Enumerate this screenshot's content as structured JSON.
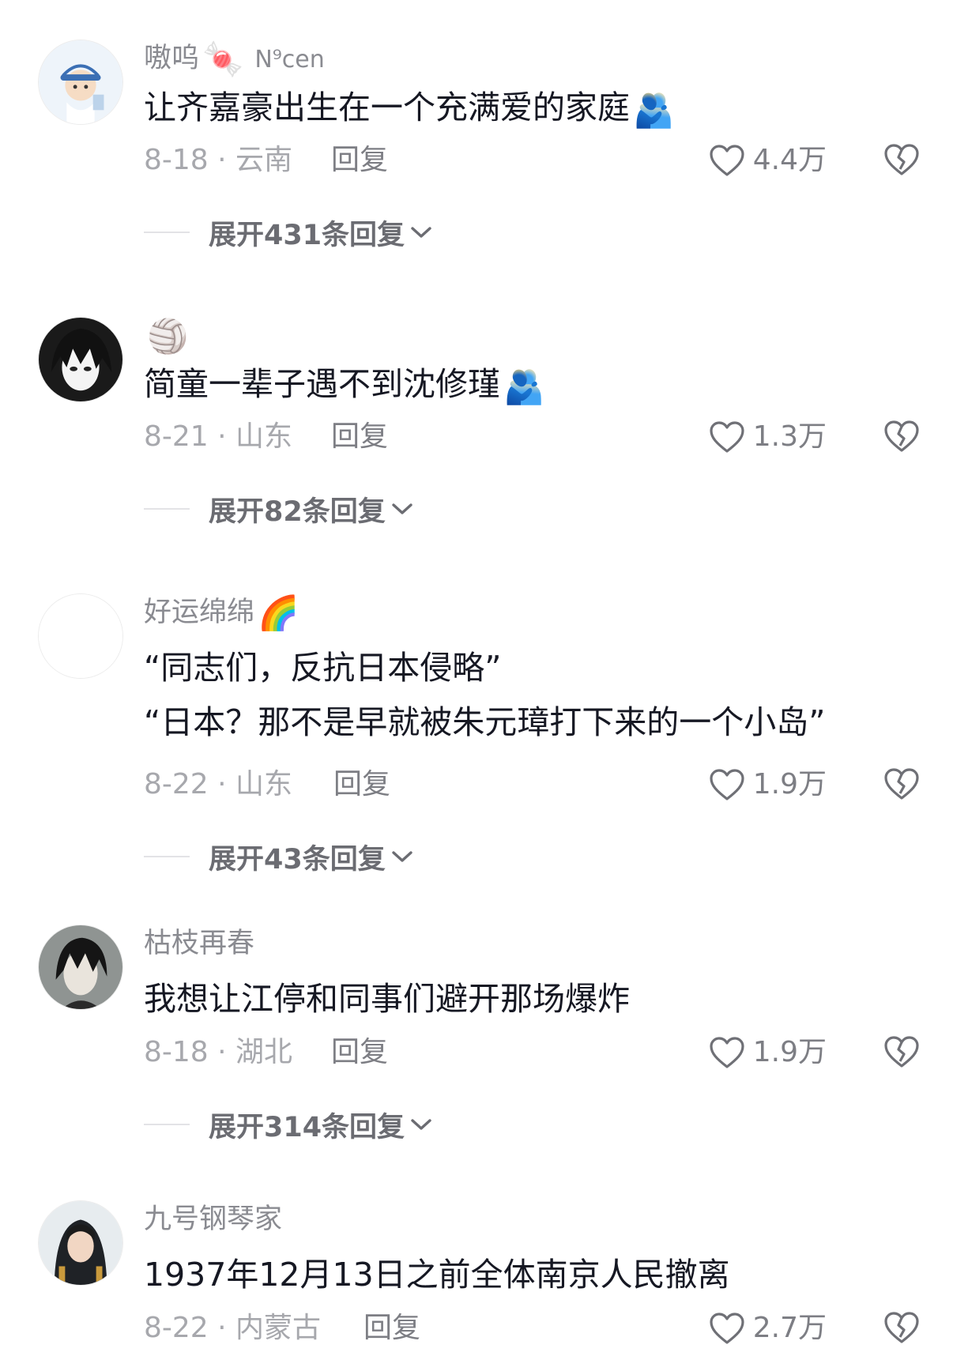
{
  "comments": [
    {
      "username": "嗷呜",
      "username_emoji": "🍬",
      "username_tag": "N⁹cen",
      "text": "让齐嘉豪出生在一个充满爱的家庭",
      "text_emoji": "🫂",
      "date_location": "8-18 · 云南",
      "reply_label": "回复",
      "likes": "4.4万",
      "expand_label": "展开431条回复"
    },
    {
      "username": "",
      "username_emoji": "🏐",
      "text": "简童一辈子遇不到沈修瑾",
      "text_emoji": "🫂",
      "date_location": "8-21 · 山东",
      "reply_label": "回复",
      "likes": "1.3万",
      "expand_label": "展开82条回复"
    },
    {
      "username": "好运绵绵",
      "username_emoji": "🌈",
      "text_line1": "“同志们，反抗日本侵略”",
      "text_line2": "“日本？那不是早就被朱元璋打下来的一个小岛”",
      "date_location": "8-22 · 山东",
      "reply_label": "回复",
      "likes": "1.9万",
      "expand_label": "展开43条回复"
    },
    {
      "username": "枯枝再春",
      "text": "我想让江停和同事们避开那场爆炸",
      "date_location": "8-18 · 湖北",
      "reply_label": "回复",
      "likes": "1.9万",
      "expand_label": "展开314条回复"
    },
    {
      "username": "九号钢琴家",
      "text": "1937年12月13日之前全体南京人民撤离",
      "date_location": "8-22 · 内蒙古",
      "reply_label": "回复",
      "likes": "2.7万"
    }
  ],
  "icons": {
    "like": "heart-outline-icon",
    "dislike": "broken-heart-icon",
    "expand": "chevron-down-icon"
  },
  "colors": {
    "text_primary": "#161823",
    "text_secondary": "#8a8b91",
    "expand_text": "#6b6c72"
  }
}
